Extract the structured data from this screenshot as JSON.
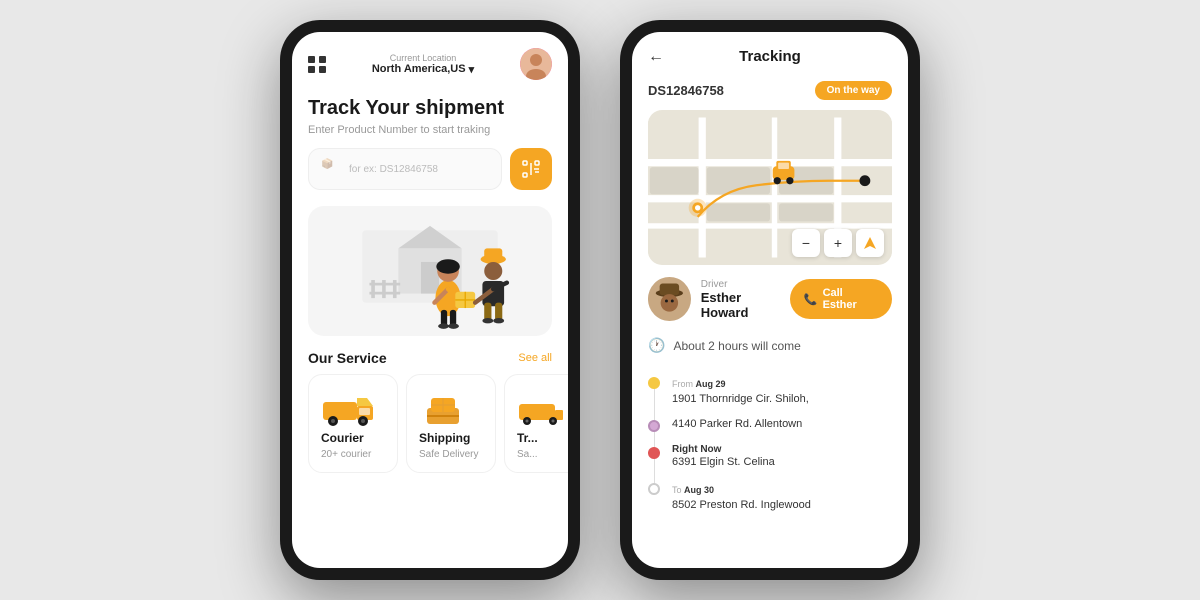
{
  "app": {
    "background": "#e8e8e8"
  },
  "phone1": {
    "header": {
      "location_label": "Current Location",
      "location_value": "North America,US",
      "dropdown_icon": "▾"
    },
    "hero": {
      "title": "Track Your shipment",
      "subtitle": "Enter Product Number to start traking",
      "input_placeholder": "for ex: DS12846758"
    },
    "service": {
      "title": "Our Service",
      "see_all": "See all",
      "cards": [
        {
          "icon": "🚚",
          "title": "Courier",
          "subtitle": "20+ courier"
        },
        {
          "icon": "📦",
          "title": "Shipping",
          "subtitle": "Safe Delivery"
        },
        {
          "icon": "🚛",
          "title": "Tr...",
          "subtitle": "Sa..."
        }
      ]
    }
  },
  "phone2": {
    "header": {
      "title": "Tracking",
      "back_icon": "←"
    },
    "tracking": {
      "id": "DS12846758",
      "status": "On the way"
    },
    "driver": {
      "label": "Driver",
      "name": "Esther Howard",
      "call_label": "Call Esther",
      "phone_icon": "📞"
    },
    "eta": {
      "text": "About 2 hours will come"
    },
    "route": [
      {
        "dot_class": "dot-yellow",
        "label": "From",
        "date": "Aug 29",
        "address": "1901 Thornridge Cir. Shiloh,"
      },
      {
        "dot_class": "dot-purple",
        "label": "",
        "date": "",
        "address": "4140 Parker Rd. Allentown"
      },
      {
        "dot_class": "dot-red",
        "label": "Right Now",
        "date": "",
        "address": "6391 Elgin St. Celina"
      },
      {
        "dot_class": "dot-white",
        "label": "To",
        "date": "Aug 30",
        "address": "8502 Preston Rd. Inglewood"
      }
    ]
  }
}
